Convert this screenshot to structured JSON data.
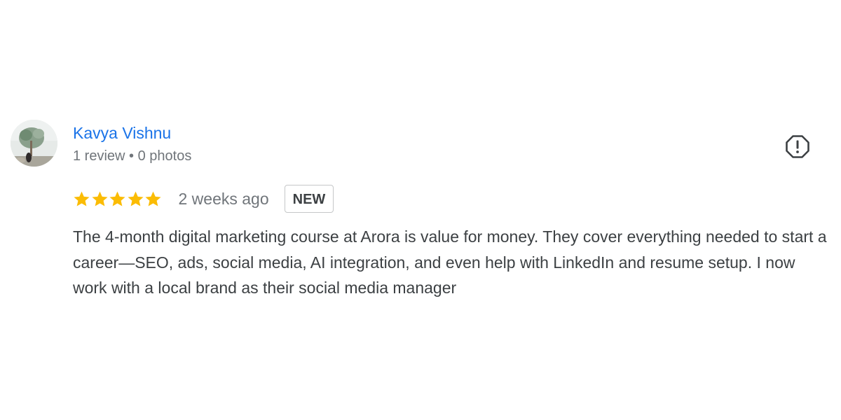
{
  "review": {
    "reviewer_name": "Kavya Vishnu",
    "reviewer_meta": "1 review • 0 photos",
    "rating": 5,
    "rating_max": 5,
    "date": "2 weeks ago",
    "badge": "NEW",
    "text": "The 4-month digital marketing course at Arora is value for money. They cover everything needed to start a career—SEO, ads, social media, AI integration, and even help with LinkedIn and resume setup. I now work with a local brand as their social media manager",
    "avatar_icon": "profile-photo",
    "flag_icon": "report-flag-icon"
  },
  "colors": {
    "name_link": "#1a73e8",
    "meta_text": "#70757a",
    "body_text": "#3c4043",
    "star": "#fbbc04",
    "badge_border": "#c5c7c8"
  }
}
